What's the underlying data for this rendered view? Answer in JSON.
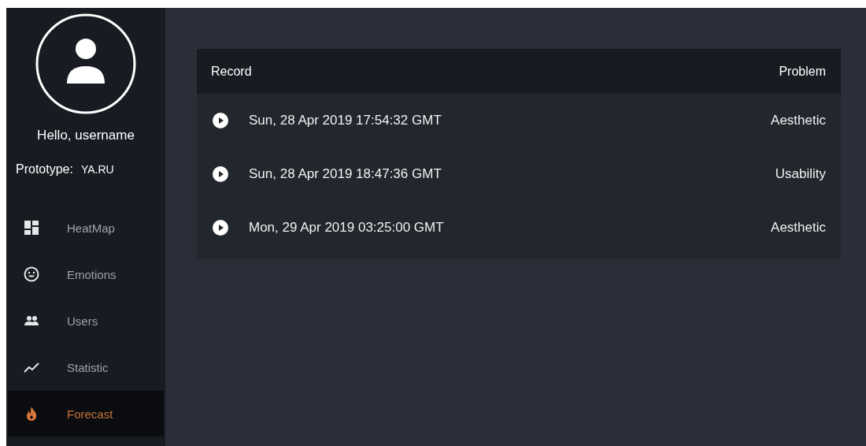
{
  "sidebar": {
    "greeting": "Hello, username",
    "prototype": {
      "label": "Prototype:",
      "value": "YA.RU"
    },
    "items": [
      {
        "label": "HeatMap",
        "selected": false
      },
      {
        "label": "Emotions",
        "selected": false
      },
      {
        "label": "Users",
        "selected": false
      },
      {
        "label": "Statistic",
        "selected": false
      },
      {
        "label": "Forecast",
        "selected": true
      }
    ]
  },
  "table": {
    "columns": [
      "Record",
      "Problem"
    ],
    "rows": [
      {
        "record": "Sun, 28 Apr 2019 17:54:32 GMT",
        "problem": "Aesthetic"
      },
      {
        "record": "Sun, 28 Apr 2019 18:47:36 GMT",
        "problem": "Usability"
      },
      {
        "record": "Mon, 29 Apr 2019 03:25:00 GMT",
        "problem": "Aesthetic"
      }
    ]
  }
}
